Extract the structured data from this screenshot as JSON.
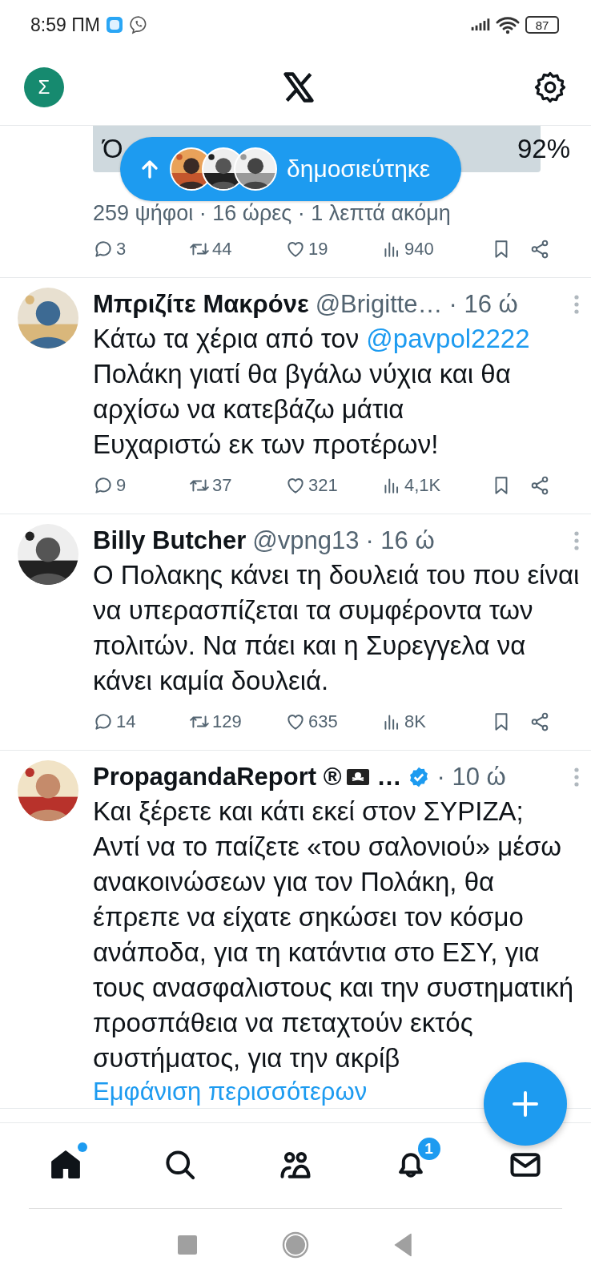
{
  "status_bar": {
    "time": "8:59 ΠΜ",
    "battery": "87"
  },
  "header": {
    "account_initial": "Σ"
  },
  "new_posts_pill": {
    "label": "δημοσιεύτηκε"
  },
  "tweets": [
    {
      "kind": "poll_tail",
      "poll": {
        "option": "Ό",
        "percent": "92%"
      },
      "votes": "259 ψήφοι · 16 ώρες · 1 λεπτά ακόμη",
      "stats": {
        "replies": "3",
        "reposts": "44",
        "likes": "19",
        "views": "940"
      }
    },
    {
      "kind": "post",
      "name": "Μπριζίτε Μακρόνε",
      "handle": "@Brigitte…",
      "time": "· 16 ώ",
      "verified": false,
      "text": [
        {
          "kind": "text",
          "text": "Κάτω τα χέρια από τον "
        },
        {
          "kind": "mention",
          "text": "@pavpol2222"
        },
        {
          "kind": "text",
          "text": " Πολάκη γιατί θα βγάλω νύχια και θα αρχίσω να κατεβάζω μάτια\nΕυχαριστώ εκ των προτέρων!"
        }
      ],
      "stats": {
        "replies": "9",
        "reposts": "37",
        "likes": "321",
        "views": "4,1K"
      }
    },
    {
      "kind": "post",
      "name": "Billy Butcher",
      "handle": "@vpng13",
      "time": "· 16 ώ",
      "verified": false,
      "text": [
        {
          "kind": "text",
          "text": "Ο Πολακης κάνει τη δουλειά του που είναι να υπερασπίζεται τα συμφέροντα των πολιτών. Να πάει και η Συρεγγελα να κάνει καμία δουλειά."
        }
      ],
      "stats": {
        "replies": "14",
        "reposts": "129",
        "likes": "635",
        "views": "8K"
      }
    },
    {
      "kind": "post",
      "name": "PropagandaReport ®",
      "flag_emoji": true,
      "name_cut": "…",
      "time": "· 10 ώ",
      "verified": true,
      "text": [
        {
          "kind": "text",
          "text": "Και ξέρετε και κάτι εκεί στον ΣΥΡΙΖΑ;\nΑντί να το παίζετε «του σαλονιού» μέσω ανακοινώσεων για τον Πολάκη, θα έπρεπε να είχατε σηκώσει τον κόσμο ανάποδα, για τη κατάντια στο ΕΣΥ, για τους ανασφαλιστους και την συστηματική προσπάθεια να πεταχτούν εκτός συστήματος, για την ακρίβ"
        }
      ],
      "show_more": "Εμφάνιση περισσότερων"
    }
  ],
  "bottom_nav": [
    {
      "kind": "home",
      "selected": true,
      "new_dot": true
    },
    {
      "kind": "search",
      "selected": false
    },
    {
      "kind": "communities",
      "selected": false
    },
    {
      "kind": "notifications",
      "selected": false,
      "badge": "1"
    },
    {
      "kind": "messages",
      "selected": false
    }
  ]
}
